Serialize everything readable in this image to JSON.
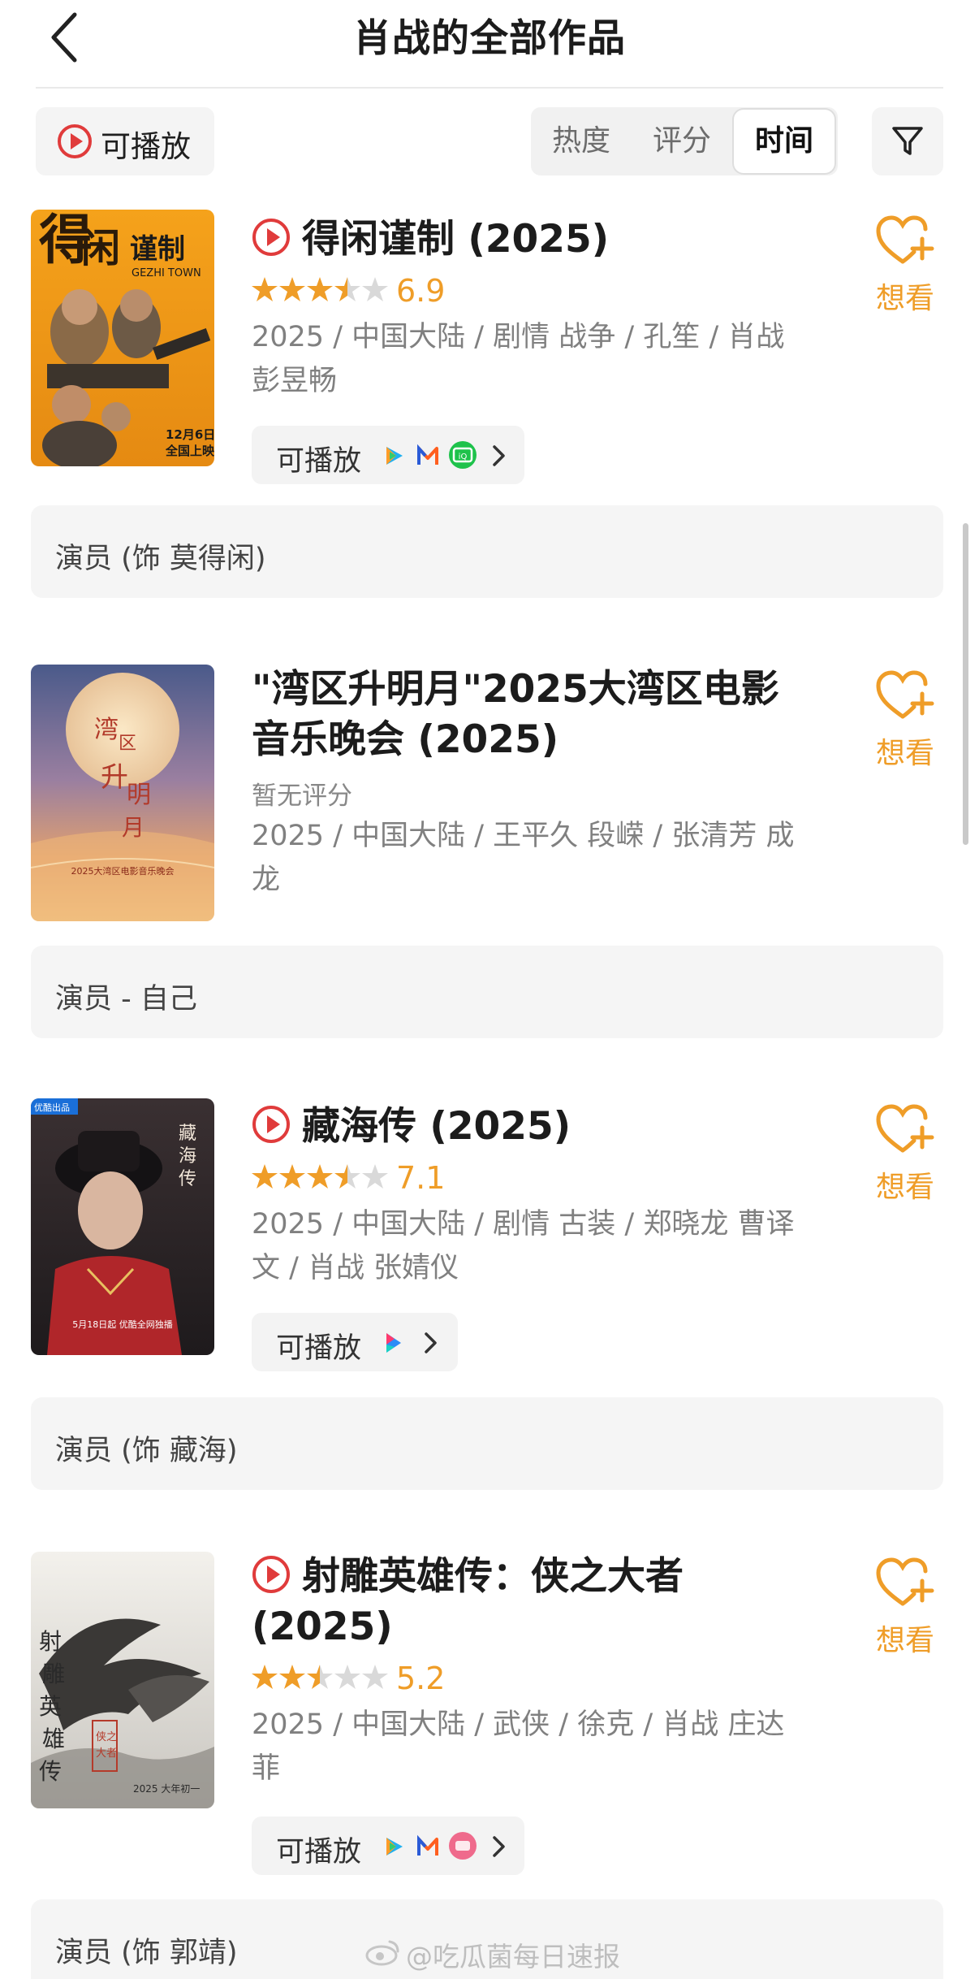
{
  "header": {
    "title": "肖战的全部作品"
  },
  "filters": {
    "playable_label": "可播放",
    "sort_options": [
      "热度",
      "评分",
      "时间"
    ],
    "active_sort": "时间"
  },
  "colors": {
    "accent": "#ef9d28",
    "play_red": "#e03b3b",
    "muted_text": "#808080"
  },
  "works": [
    {
      "title": "得闲谨制 (2025)",
      "has_play_icon": true,
      "rating": 6.9,
      "rating_text": "6.9",
      "stars": 3.5,
      "meta": "2025 / 中国大陆 / 剧情 战争 / 孔笙 / 肖战 彭昱畅",
      "playable_label": "可播放",
      "platforms": [
        "tencent-video-icon",
        "mgtv-icon",
        "iqiyi-icon"
      ],
      "wish_label": "想看",
      "role": "演员 (饰 莫得闲)",
      "poster_text": [
        "得闲谨制",
        "GEZHI TOWN",
        "12月6日",
        "全国上映"
      ]
    },
    {
      "title": "\"湾区升明月\"2025大湾区电影音乐晚会 (2025)",
      "has_play_icon": false,
      "no_rating_text": "暂无评分",
      "meta": "2025 / 中国大陆 / 王平久 段嵘 / 张清芳 成龙",
      "wish_label": "想看",
      "role": "演员 - 自己",
      "poster_text": [
        "湾区升明月",
        "2025大湾区电影音乐晚会"
      ]
    },
    {
      "title": "藏海传 (2025)",
      "has_play_icon": true,
      "rating": 7.1,
      "rating_text": "7.1",
      "stars": 3.5,
      "meta": "2025 / 中国大陆 / 剧情 古装 / 郑晓龙 曹译文 / 肖战 张婧仪",
      "playable_label": "可播放",
      "platforms": [
        "youku-icon"
      ],
      "wish_label": "想看",
      "role": "演员 (饰 藏海)",
      "poster_text": [
        "优酷出品",
        "藏海传",
        "5月18日起 优酷全网独播"
      ]
    },
    {
      "title": "射雕英雄传：侠之大者 (2025)",
      "has_play_icon": true,
      "rating": 5.2,
      "rating_text": "5.2",
      "stars": 2.5,
      "meta": "2025 / 中国大陆 / 武侠 / 徐克 / 肖战 庄达菲",
      "playable_label": "可播放",
      "platforms": [
        "tencent-video-icon",
        "mgtv-icon",
        "pink-platform-icon"
      ],
      "wish_label": "想看",
      "role": "演员 (饰 郭靖)",
      "poster_text": [
        "射雕英雄传",
        "侠之大者",
        "2025 大年初一"
      ]
    }
  ],
  "watermark": "@吃瓜菌每日速报"
}
